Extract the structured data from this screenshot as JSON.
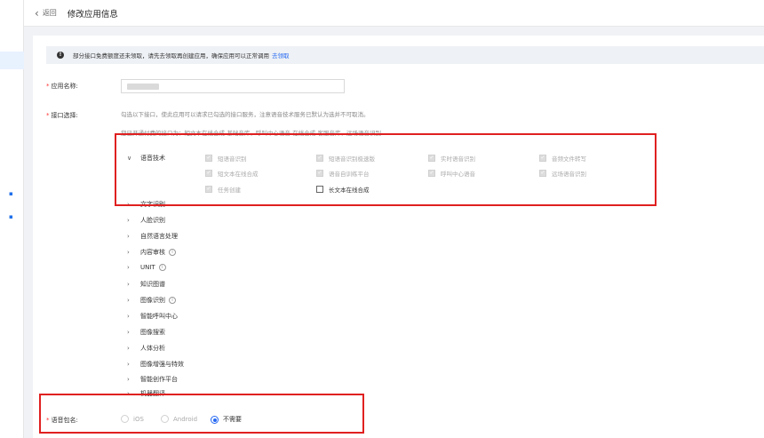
{
  "header": {
    "back_chevron": "‹",
    "back_label": "返回",
    "title": "修改应用信息"
  },
  "notice": {
    "icon": "!",
    "text": "部分接口免费额度还未领取，请先去领取再创建应用，确保应用可以正常调用",
    "link": "去领取"
  },
  "form": {
    "app_name_label": "应用名称:",
    "required_mark": "*",
    "interface_label": "接口选择:",
    "hint": "勾选以下接口，使此应用可以请求已勾选的接口服务，注意语音技术服务已默认为选并不可取消。",
    "hint2": "您已开通付费的接口为：短文本在线合成-基础音库、呼叫中心语音-在线合成-客服音库、远场语音识别",
    "voice_pkg_label": "语音包名:"
  },
  "speech": {
    "category": "语音技术",
    "expand_icon": "∨",
    "items": [
      {
        "label": "短语音识别",
        "checked": true,
        "disabled": true
      },
      {
        "label": "短语音识别极速版",
        "checked": true,
        "disabled": true
      },
      {
        "label": "实时语音识别",
        "checked": true,
        "disabled": true
      },
      {
        "label": "音频文件转写",
        "checked": true,
        "disabled": true
      },
      {
        "label": "短文本在线合成",
        "checked": true,
        "disabled": true
      },
      {
        "label": "语音自训练平台",
        "checked": true,
        "disabled": true
      },
      {
        "label": "呼叫中心语音",
        "checked": true,
        "disabled": true
      },
      {
        "label": "远场语音识别",
        "checked": true,
        "disabled": true
      },
      {
        "label": "任务创建",
        "checked": true,
        "disabled": true
      },
      {
        "label": "长文本在线合成",
        "checked": false,
        "disabled": false
      }
    ]
  },
  "categories": {
    "collapse_icon": "›",
    "help_icon": "i",
    "items": [
      "文字识别",
      "人脸识别",
      "自然语言处理",
      "内容审核",
      "UNIT",
      "知识图谱",
      "图像识别",
      "智能呼叫中心",
      "图像搜索",
      "人体分析",
      "图像增强与特效",
      "智能创作平台",
      "机器翻译"
    ]
  },
  "voice_package": {
    "options": [
      "iOS",
      "Android",
      "不需要"
    ],
    "selected": "不需要"
  },
  "colors": {
    "accent": "#2468f2",
    "highlight_box": "#e02020"
  }
}
